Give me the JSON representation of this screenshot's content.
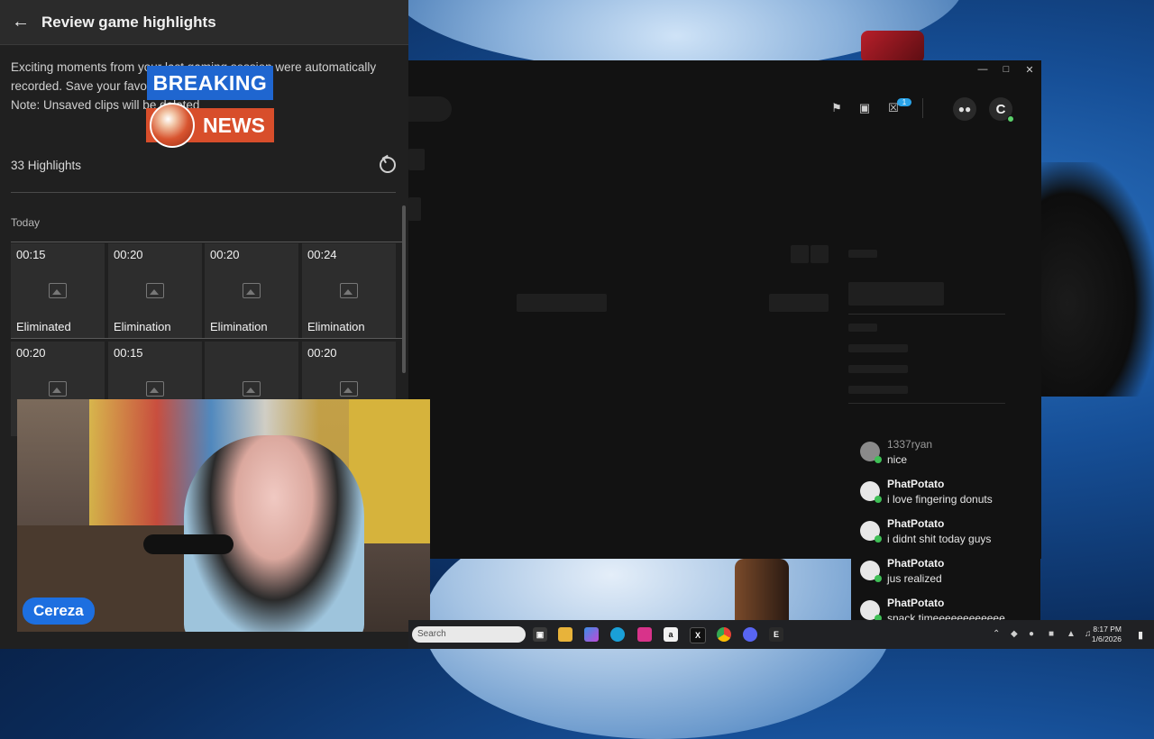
{
  "panel": {
    "title": "Review game highlights",
    "description": "Exciting moments from your last gaming session were automatically recorded. Save your favourite clips to the gallery\nNote: Unsaved clips will be deleted",
    "highlight_count": "33 Highlights",
    "section": "Today",
    "clips_row1": [
      {
        "duration": "00:15",
        "type": "Eliminated"
      },
      {
        "duration": "00:20",
        "type": "Elimination"
      },
      {
        "duration": "00:20",
        "type": "Elimination"
      },
      {
        "duration": "00:24",
        "type": "Elimination"
      }
    ],
    "clips_row2": [
      {
        "duration": "00:20",
        "type": ""
      },
      {
        "duration": "00:15",
        "type": ""
      },
      {
        "duration": "",
        "type": ""
      },
      {
        "duration": "00:20",
        "type": ""
      }
    ]
  },
  "overlay": {
    "breaking": "BREAKING",
    "news": "NEWS",
    "streamer_name": "Cereza"
  },
  "app": {
    "avatar_initial": "C",
    "cart_badge": "1"
  },
  "chat": [
    {
      "user": "1337ryan",
      "text": "nice"
    },
    {
      "user": "PhatPotato",
      "text": "i love fingering donuts"
    },
    {
      "user": "PhatPotato",
      "text": "i didnt shit today guys"
    },
    {
      "user": "PhatPotato",
      "text": "jus realized"
    },
    {
      "user": "PhatPotato",
      "text": "snack timeeeeeeeeeeee"
    }
  ],
  "taskbar": {
    "search_placeholder": "Search",
    "time": "8:17 PM",
    "date": "1/6/2026"
  },
  "colors": {
    "breaking_bg": "#1f66d0",
    "news_bg": "#d84e2b",
    "name_tag_bg": "#1d6fe0",
    "online_dot": "#3fbf56"
  }
}
